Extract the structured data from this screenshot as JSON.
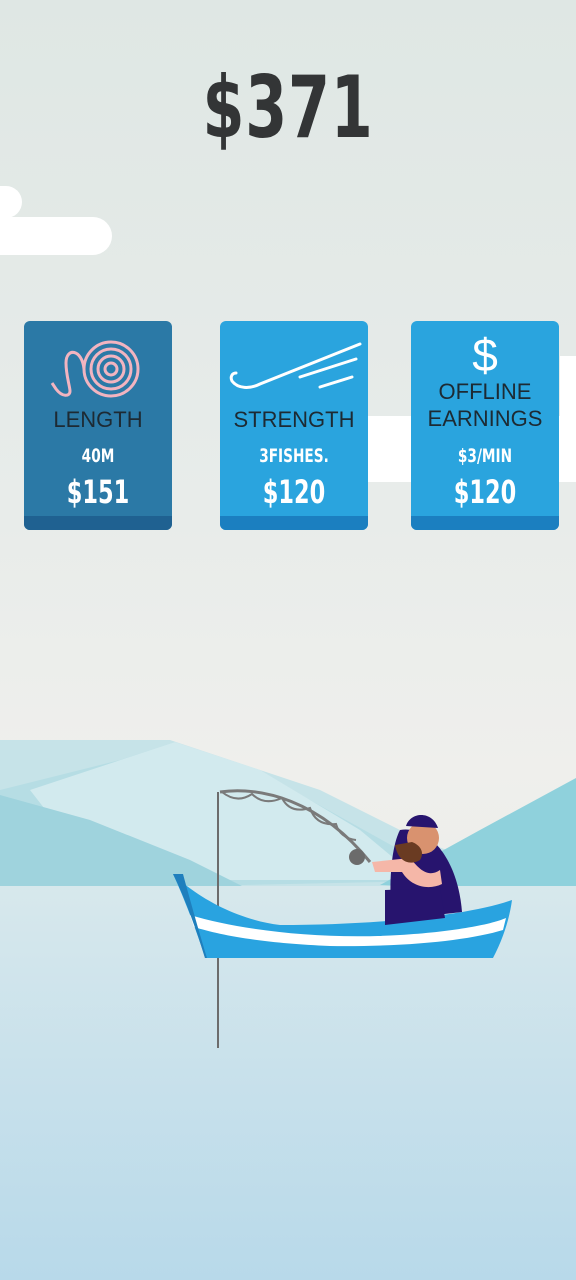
{
  "hud": {
    "money": "$371"
  },
  "upgrades": [
    {
      "id": "length",
      "title": "LENGTH",
      "detail": "40M",
      "price": "$151",
      "icon": "rope-hook-icon",
      "card_color": "#2b79a6",
      "bar_color": "#1f6191"
    },
    {
      "id": "strength",
      "title": "STRENGTH",
      "detail": "3FISHES.",
      "price": "$120",
      "icon": "hook-icon",
      "card_color": "#2aa4de",
      "bar_color": "#1b7fc0"
    },
    {
      "id": "offline",
      "title_line1": "OFFLINE",
      "title_line2": "EARNINGS",
      "detail": "$3/MIN",
      "price": "$120",
      "icon": "dollar-icon",
      "card_color": "#2aa4de",
      "bar_color": "#1b7fc0"
    }
  ],
  "colors": {
    "water": "#cde3ea",
    "boat": "#29a3e0",
    "fisher_shirt": "#27146e"
  }
}
